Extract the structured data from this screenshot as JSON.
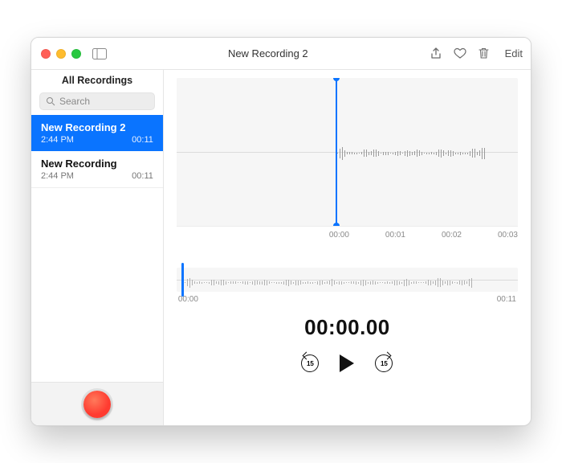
{
  "titlebar": {
    "title": "New Recording 2",
    "edit_label": "Edit"
  },
  "sidebar": {
    "heading": "All Recordings",
    "search_placeholder": "Search",
    "items": [
      {
        "name": "New Recording 2",
        "time": "2:44 PM",
        "duration": "00:11",
        "selected": true
      },
      {
        "name": "New Recording",
        "time": "2:44 PM",
        "duration": "00:11",
        "selected": false
      }
    ]
  },
  "detail": {
    "zoom_ruler": [
      "00:00",
      "00:01",
      "00:02",
      "00:03"
    ],
    "mini_start": "00:00",
    "mini_end": "00:11",
    "big_time": "00:00.00",
    "skip_seconds": "15"
  },
  "colors": {
    "accent": "#0a74ff",
    "record": "#ff3b30"
  }
}
